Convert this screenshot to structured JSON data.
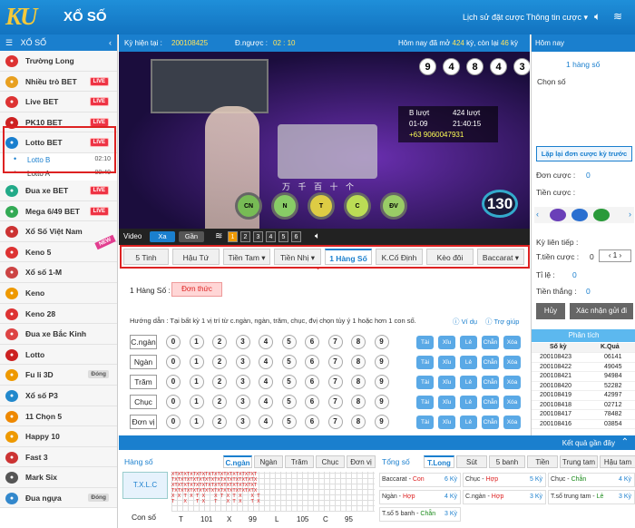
{
  "header": {
    "logo": "KU",
    "title": "XỔ SỐ",
    "history_link": "Lịch sử đặt cược",
    "bet_info": "Thông tin cược ▾",
    "sound_icon": "speaker-icon",
    "wifi_icon": "wifi-icon"
  },
  "sidebar": {
    "title": "XỔ SỐ",
    "items": [
      {
        "label": "Trường Long",
        "badge": "",
        "color": "#d33"
      },
      {
        "label": "Nhiều trò BET",
        "badge": "LIVE",
        "color": "#e8a020"
      },
      {
        "label": "Live BET",
        "badge": "LIVE",
        "color": "#d33"
      },
      {
        "label": "PK10 BET",
        "badge": "LIVE",
        "color": "#c22"
      },
      {
        "label": "Lotto BET",
        "badge": "LIVE",
        "color": "#1a7fce"
      },
      {
        "label": "Đua xe BET",
        "badge": "LIVE",
        "color": "#2a8"
      },
      {
        "label": "Mega 6/49 BET",
        "badge": "LIVE",
        "color": "#3a5"
      },
      {
        "label": "Xổ Số Việt Nam",
        "badge": "",
        "color": "#c33"
      },
      {
        "label": "Keno 5",
        "badge": "",
        "color": "#d33"
      },
      {
        "label": "Xổ số 1-M",
        "badge": "",
        "color": "#c44"
      },
      {
        "label": "Keno",
        "badge": "",
        "color": "#e90"
      },
      {
        "label": "Keno 28",
        "badge": "",
        "color": "#d33"
      },
      {
        "label": "Đua xe Bắc Kinh",
        "badge": "",
        "color": "#d44"
      },
      {
        "label": "Lotto",
        "badge": "",
        "color": "#c22"
      },
      {
        "label": "Fu li 3D",
        "badge": "Đóng",
        "color": "#e90"
      },
      {
        "label": "Xổ số P3",
        "badge": "",
        "color": "#28c"
      },
      {
        "label": "11 Chọn 5",
        "badge": "",
        "color": "#e80"
      },
      {
        "label": "Happy 10",
        "badge": "",
        "color": "#e90"
      },
      {
        "label": "Fast 3",
        "badge": "",
        "color": "#c33"
      },
      {
        "label": "Mark Six",
        "badge": "",
        "color": "#555"
      },
      {
        "label": "Đua ngựa",
        "badge": "Đóng",
        "color": "#38c"
      }
    ],
    "subitems": [
      {
        "label": "Lotto B",
        "time": "02:10"
      },
      {
        "label": "Lotto A",
        "time": "00:40"
      }
    ],
    "new_tag": "NEW"
  },
  "infobar": {
    "period_label": "Kỳ hiện tại :",
    "period": "200108425",
    "countdown_label": "Đ.ngược :",
    "countdown": "02 : 10",
    "today_prefix": "Hôm nay đã mở",
    "today_open": "424",
    "today_mid": "kỳ, còn lại",
    "today_left": "46",
    "today_suffix": "kỳ"
  },
  "video": {
    "balls": [
      "9",
      "4",
      "8",
      "4",
      "3"
    ],
    "b_label": "B lượt",
    "b_count": "424 lượt",
    "date": "01-09",
    "time": "21:40:15",
    "phone": "+63 9060047931",
    "spheres": [
      "CN",
      "N",
      "T",
      "C",
      "ĐV"
    ],
    "big_num": "130",
    "place_labels": "万 千 百 十 个"
  },
  "video_bar": {
    "label": "Video",
    "btn_xa": "Xa",
    "btn_gan": "Gần",
    "chips": [
      "1",
      "2",
      "3",
      "4",
      "5",
      "6"
    ]
  },
  "tabs": [
    {
      "label": "5 Tinh",
      "active": false
    },
    {
      "label": "Hậu Tứ",
      "active": false
    },
    {
      "label": "Tiền Tam ▾",
      "active": false
    },
    {
      "label": "Tiền Nhị ▾",
      "active": false
    },
    {
      "label": "1 Hàng Số",
      "active": true
    },
    {
      "label": "K.Cố Định",
      "active": false
    },
    {
      "label": "Kèo đôi",
      "active": false
    },
    {
      "label": "Baccarat ▾",
      "active": false
    }
  ],
  "content": {
    "mode_label": "1 Hàng Số :",
    "mode_btn": "Đơn thức",
    "guide": "Hướng dẫn : Tại bất kỳ 1 vị trí từ c.ngàn, ngàn, trăm, chục, đvị chọn tùy ý 1 hoặc hơn 1 con số.",
    "example": "Ví dụ",
    "help": "Trợ giúp",
    "rows": [
      {
        "label": "C.ngàn"
      },
      {
        "label": "Ngàn"
      },
      {
        "label": "Trăm"
      },
      {
        "label": "Chục"
      },
      {
        "label": "Đơn vị"
      }
    ],
    "digits": [
      "0",
      "1",
      "2",
      "3",
      "4",
      "5",
      "6",
      "7",
      "8",
      "9"
    ],
    "options": [
      "Tài",
      "Xỉu",
      "Lẻ",
      "Chẵn",
      "Xóa"
    ]
  },
  "right": {
    "today": "Hôm nay",
    "mode": "1 hàng số",
    "choose": "Chọn số",
    "repeat_btn": "Lặp lại đơn cược kỳ trước",
    "bet_label": "Đơn cược :",
    "bet_val": "0",
    "bet_money_label": "Tiền cược :",
    "next_label": "Kỳ liên tiếp :",
    "stake_label": "T.tiền cược :",
    "stake_prefix": "0",
    "stake_input": "1",
    "rate_label": "Tỉ lệ :",
    "rate_val": "0",
    "win_label": "Tiền thắng :",
    "win_val": "0",
    "cancel_btn": "Hủy",
    "confirm_btn": "Xác nhận gửi đi",
    "analysis": "Phân tích",
    "col_ky": "Số kỳ",
    "col_kq": "K.Quả",
    "history": [
      {
        "ky": "200108423",
        "kq": "06141"
      },
      {
        "ky": "200108422",
        "kq": "49045"
      },
      {
        "ky": "200108421",
        "kq": "94984"
      },
      {
        "ky": "200108420",
        "kq": "52282"
      },
      {
        "ky": "200108419",
        "kq": "42997"
      },
      {
        "ky": "200108418",
        "kq": "02712"
      },
      {
        "ky": "200108417",
        "kq": "78482"
      },
      {
        "ky": "200108416",
        "kq": "03854"
      }
    ]
  },
  "bottom": {
    "recent": "Kết quả gần đây",
    "left_title": "Hàng số",
    "left_btn": "T.X.L.C",
    "left_sub": "Con số",
    "col_tabs": [
      "C.ngàn",
      "Ngàn",
      "Trăm",
      "Chục",
      "Đơn vị"
    ],
    "sum_title": "Tổng số",
    "right_tabs": [
      "T.Long",
      "Sút",
      "5 banh",
      "Tiền",
      "Trung tam",
      "Hậu tam"
    ],
    "tx_row": [
      {
        "k": "T",
        "v": "101"
      },
      {
        "k": "X",
        "v": "99"
      },
      {
        "k": "L",
        "v": "105"
      },
      {
        "k": "C",
        "v": "95"
      }
    ],
    "grid_text": "XTXTXTXTXTXTXTXTXTXTXTXTXTXT\nTXTXTXTXTXTXTXTXTXTXTXTXTXTX\nXTXTXTXTXTXTXTXTXTXTXTXTXTXT\nTXTXTXTXTXTXTXTXTXTXTXTXTXTX\nX X T X T X   X T X T X   X T\nT   X   T X   T   X T X   T X",
    "results": [
      {
        "label": "Baccarat - ",
        "hl": "Con",
        "ky": "6 Kỳ"
      },
      {
        "label": "Chục - ",
        "hl": "Hợp",
        "ky": "5 Kỳ"
      },
      {
        "label": "Chục - ",
        "hl": "Chẵn",
        "ky": "4 Kỳ"
      },
      {
        "label": "Ngàn - ",
        "hl": "Hợp",
        "ky": "4 Kỳ"
      },
      {
        "label": "C.ngàn - ",
        "hl": "Hợp",
        "ky": "3 Kỳ"
      },
      {
        "label": "T.số trung tam - ",
        "hl": "Lẻ",
        "ky": "3 Kỳ"
      },
      {
        "label": "T.số 5 banh - ",
        "hl": "Chẵn",
        "ky": "3 Kỳ"
      }
    ]
  }
}
